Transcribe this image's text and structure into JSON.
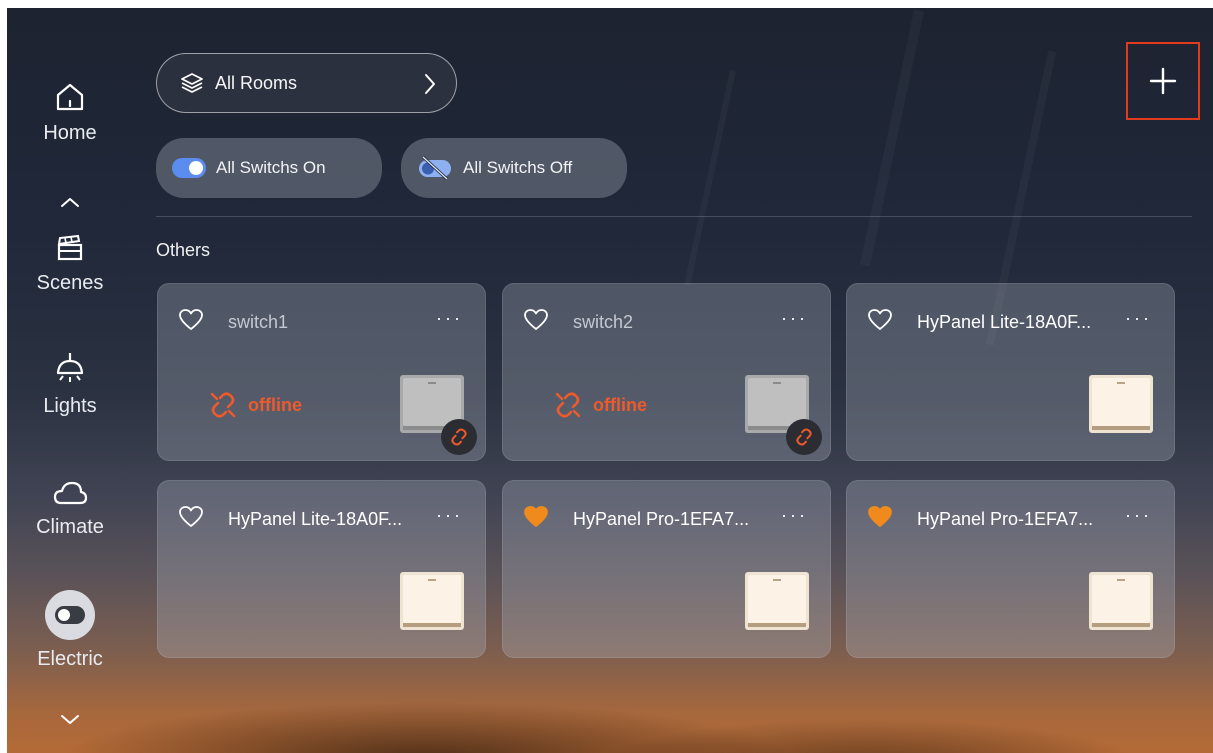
{
  "sidebar": {
    "items": [
      {
        "label": "Home",
        "icon": "home-icon"
      },
      {
        "label": "Scenes",
        "icon": "clapperboard-icon"
      },
      {
        "label": "Lights",
        "icon": "ceiling-lamp-icon"
      },
      {
        "label": "Climate",
        "icon": "cloud-icon"
      },
      {
        "label": "Electric",
        "icon": "toggle-icon",
        "active": true
      }
    ]
  },
  "header": {
    "room_selector": "All Rooms",
    "add_icon": "plus-icon"
  },
  "quick_actions": {
    "all_on": "All Switchs On",
    "all_off": "All Switchs Off"
  },
  "section": {
    "title": "Others"
  },
  "devices": [
    {
      "name": "switch1",
      "status": "offline",
      "favorite": false
    },
    {
      "name": "switch2",
      "status": "offline",
      "favorite": false
    },
    {
      "name": "HyPanel Lite-18A0F...",
      "status": "",
      "favorite": false
    },
    {
      "name": "HyPanel Lite-18A0F...",
      "status": "",
      "favorite": false
    },
    {
      "name": "HyPanel Pro-1EFA7...",
      "status": "",
      "favorite": true
    },
    {
      "name": "HyPanel Pro-1EFA7...",
      "status": "",
      "favorite": true
    }
  ],
  "more_glyph": "···",
  "colors": {
    "offline": "#ee5a2c",
    "favorite": "#f08a1c",
    "add_highlight": "#e23a1d"
  }
}
